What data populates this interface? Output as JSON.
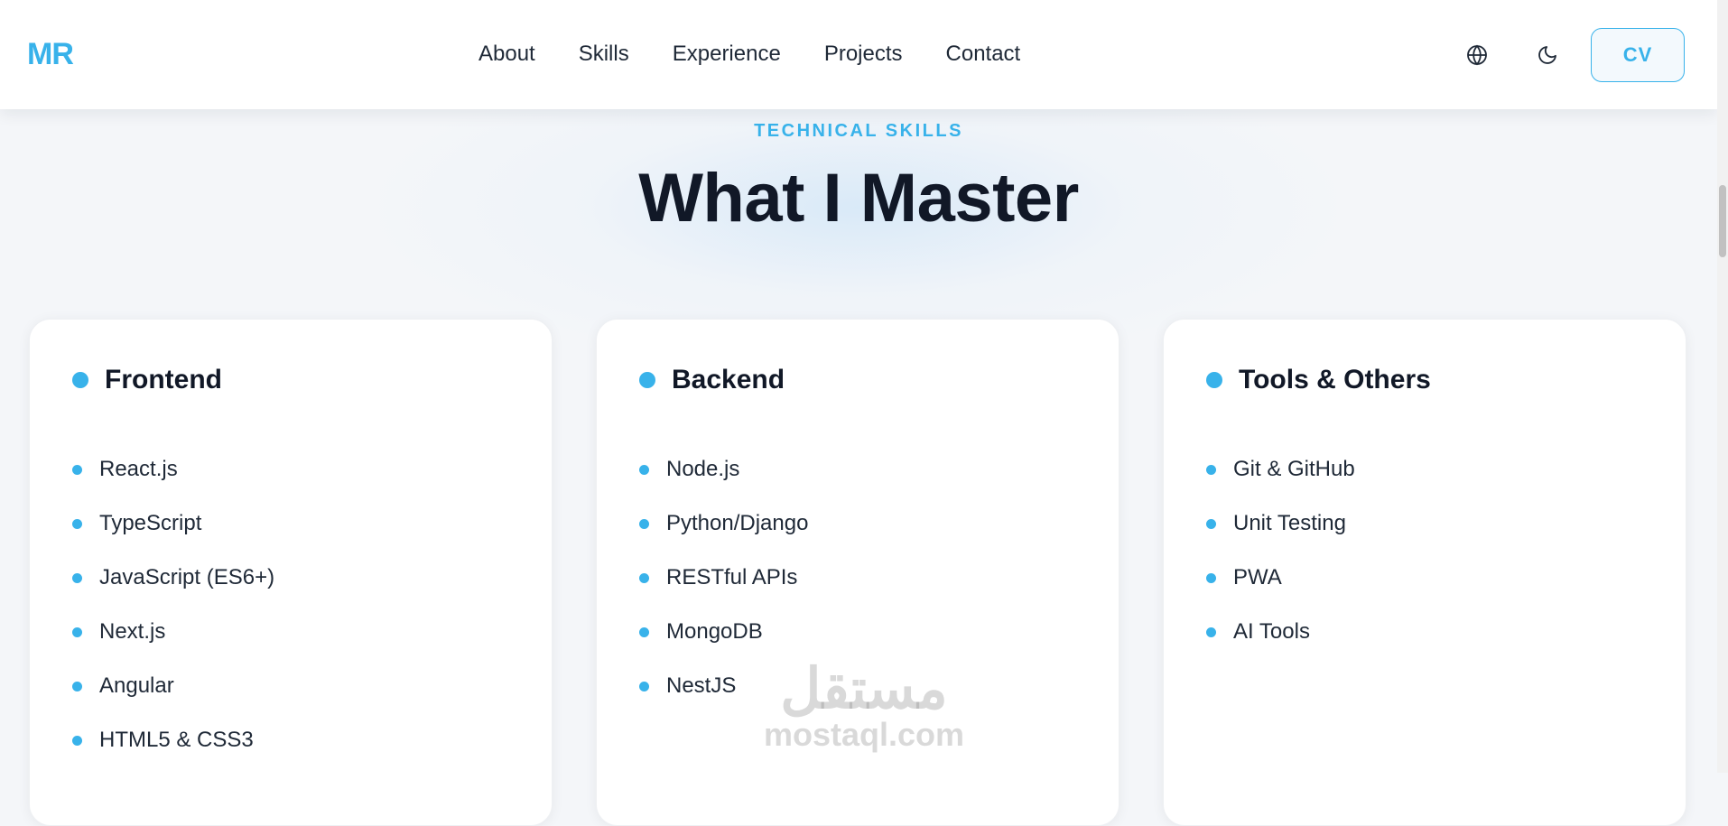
{
  "nav": {
    "logo": "MR",
    "links": [
      "About",
      "Skills",
      "Experience",
      "Projects",
      "Contact"
    ],
    "language_icon": "globe-icon",
    "theme_icon": "moon-icon",
    "cv_label": "CV"
  },
  "section": {
    "label": "TECHNICAL SKILLS",
    "title": "What I Master"
  },
  "cards": [
    {
      "title": "Frontend",
      "skills": [
        "React.js",
        "TypeScript",
        "JavaScript (ES6+)",
        "Next.js",
        "Angular",
        "HTML5 & CSS3"
      ]
    },
    {
      "title": "Backend",
      "skills": [
        "Node.js",
        "Python/Django",
        "RESTful APIs",
        "MongoDB",
        "NestJS"
      ]
    },
    {
      "title": "Tools & Others",
      "skills": [
        "Git & GitHub",
        "Unit Testing",
        "PWA",
        "AI Tools"
      ]
    }
  ],
  "watermark": {
    "arabic": "مستقل",
    "latin": "mostaql.com"
  },
  "colors": {
    "accent": "#38b2ea",
    "text": "#111827",
    "background": "#f4f6f9"
  }
}
